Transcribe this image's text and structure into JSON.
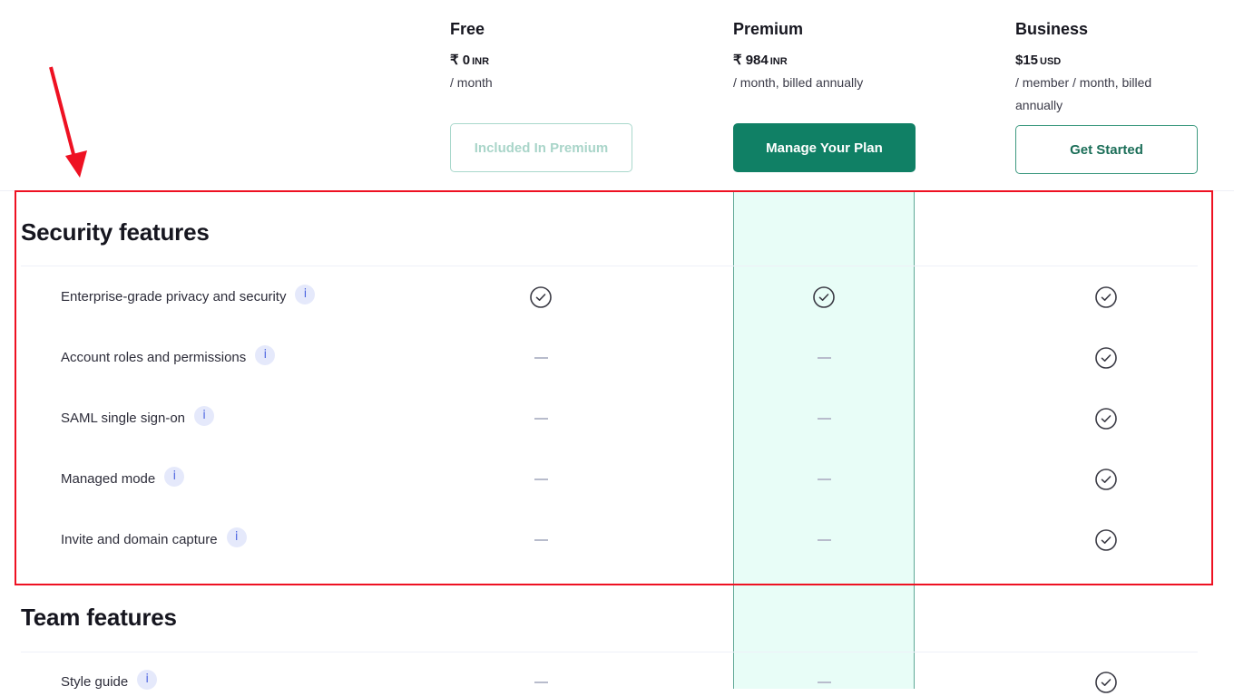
{
  "plans": [
    {
      "name": "Free",
      "price": "₹ 0",
      "currency": "INR",
      "period": "/ month",
      "button": "Included In Premium",
      "button_state": "disabled"
    },
    {
      "name": "Premium",
      "price": "₹ 984",
      "currency": "INR",
      "period": "/ month, billed annually",
      "button": "Manage Your Plan",
      "button_state": "primary"
    },
    {
      "name": "Business",
      "price": "$15",
      "currency": "USD",
      "period": "/ member / month, billed annually",
      "button": "Get Started",
      "button_state": "outline"
    }
  ],
  "sections": [
    {
      "title": "Security features",
      "features": [
        {
          "label": "Enterprise-grade privacy and security",
          "free": "check",
          "premium": "check",
          "business": "check"
        },
        {
          "label": "Account roles and permissions",
          "free": "dash",
          "premium": "dash",
          "business": "check"
        },
        {
          "label": "SAML single sign-on",
          "free": "dash",
          "premium": "dash",
          "business": "check"
        },
        {
          "label": "Managed mode",
          "free": "dash",
          "premium": "dash",
          "business": "check"
        },
        {
          "label": "Invite and domain capture",
          "free": "dash",
          "premium": "dash",
          "business": "check"
        }
      ]
    },
    {
      "title": "Team features",
      "features": [
        {
          "label": "Style guide",
          "free": "dash",
          "premium": "dash",
          "business": "check"
        }
      ]
    }
  ],
  "icons": {
    "info": "i",
    "check": "check-circle-icon",
    "dash": "dash-icon"
  },
  "colors": {
    "accent": "#108065",
    "premium_bg": "#e8fdf7",
    "annotation": "#ee1122",
    "info_bg": "#e5e9fb"
  }
}
